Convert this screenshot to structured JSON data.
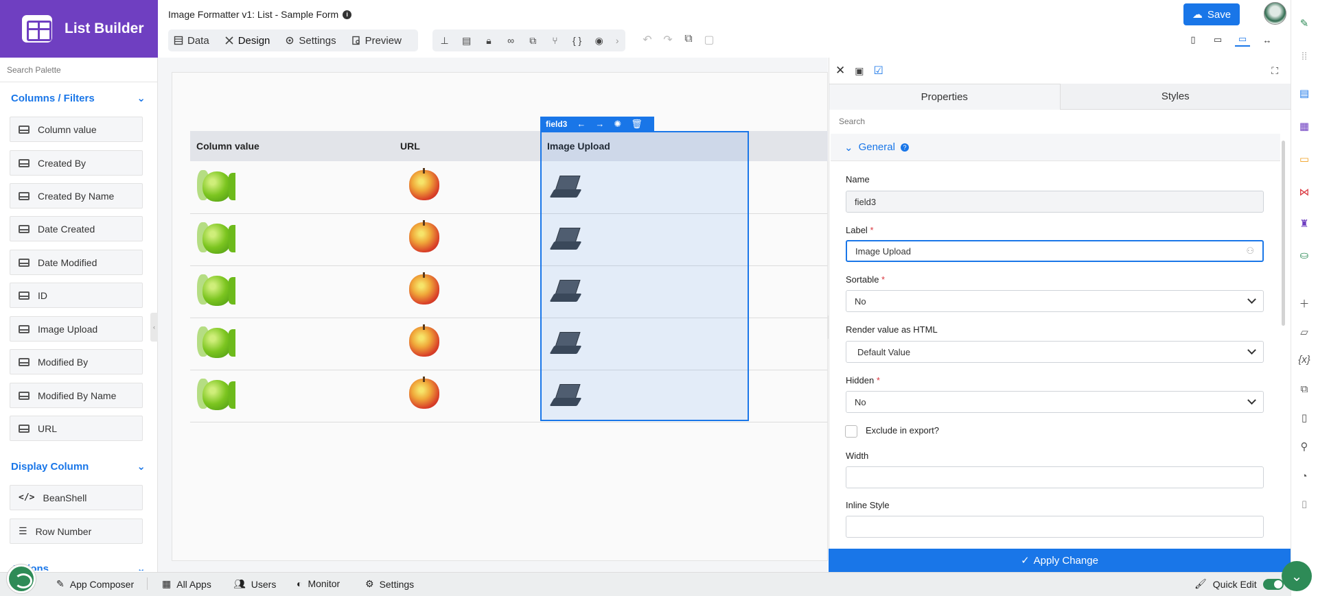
{
  "brand": {
    "title": "List Builder"
  },
  "header": {
    "form_title": "Image Formatter v1: List - Sample Form",
    "tabs": [
      {
        "label": "Data",
        "icon": "data-icon"
      },
      {
        "label": "Design",
        "icon": "design-icon"
      },
      {
        "label": "Settings",
        "icon": "gear-icon"
      },
      {
        "label": "Preview",
        "icon": "preview-icon"
      }
    ],
    "active_tab": "Design",
    "save_label": "Save"
  },
  "palette": {
    "search_placeholder": "Search Palette",
    "sections": [
      {
        "title": "Columns / Filters"
      },
      {
        "title": "Display Column"
      },
      {
        "title": "Actions"
      }
    ],
    "columns": [
      "Column value",
      "Created By",
      "Created By Name",
      "Date Created",
      "Date Modified",
      "ID",
      "Image Upload",
      "Modified By",
      "Modified By Name",
      "URL"
    ],
    "display_columns": [
      "BeanShell",
      "Row Number"
    ]
  },
  "table": {
    "headers": [
      "Column value",
      "URL",
      "Image Upload"
    ],
    "row_count": 5,
    "selected_field": "field3"
  },
  "properties": {
    "tabs": [
      "Properties",
      "Styles"
    ],
    "search_placeholder": "Search",
    "section": "General",
    "name_label": "Name",
    "name_value": "field3",
    "label_label": "Label",
    "label_value": "Image Upload",
    "sortable_label": "Sortable",
    "sortable_value": "No",
    "render_label": "Render value as HTML",
    "render_value": "Default Value",
    "hidden_label": "Hidden",
    "hidden_value": "No",
    "exclude_label": "Exclude in export?",
    "width_label": "Width",
    "inline_style_label": "Inline Style",
    "apply_label": "Apply Change"
  },
  "bottom_bar": {
    "items": [
      "App Composer",
      "All Apps",
      "Users",
      "Monitor",
      "Settings"
    ],
    "quick_edit": "Quick Edit"
  },
  "colors": {
    "brand": "#6f3fc1",
    "accent": "#1976e8",
    "green": "#2e8b57"
  }
}
